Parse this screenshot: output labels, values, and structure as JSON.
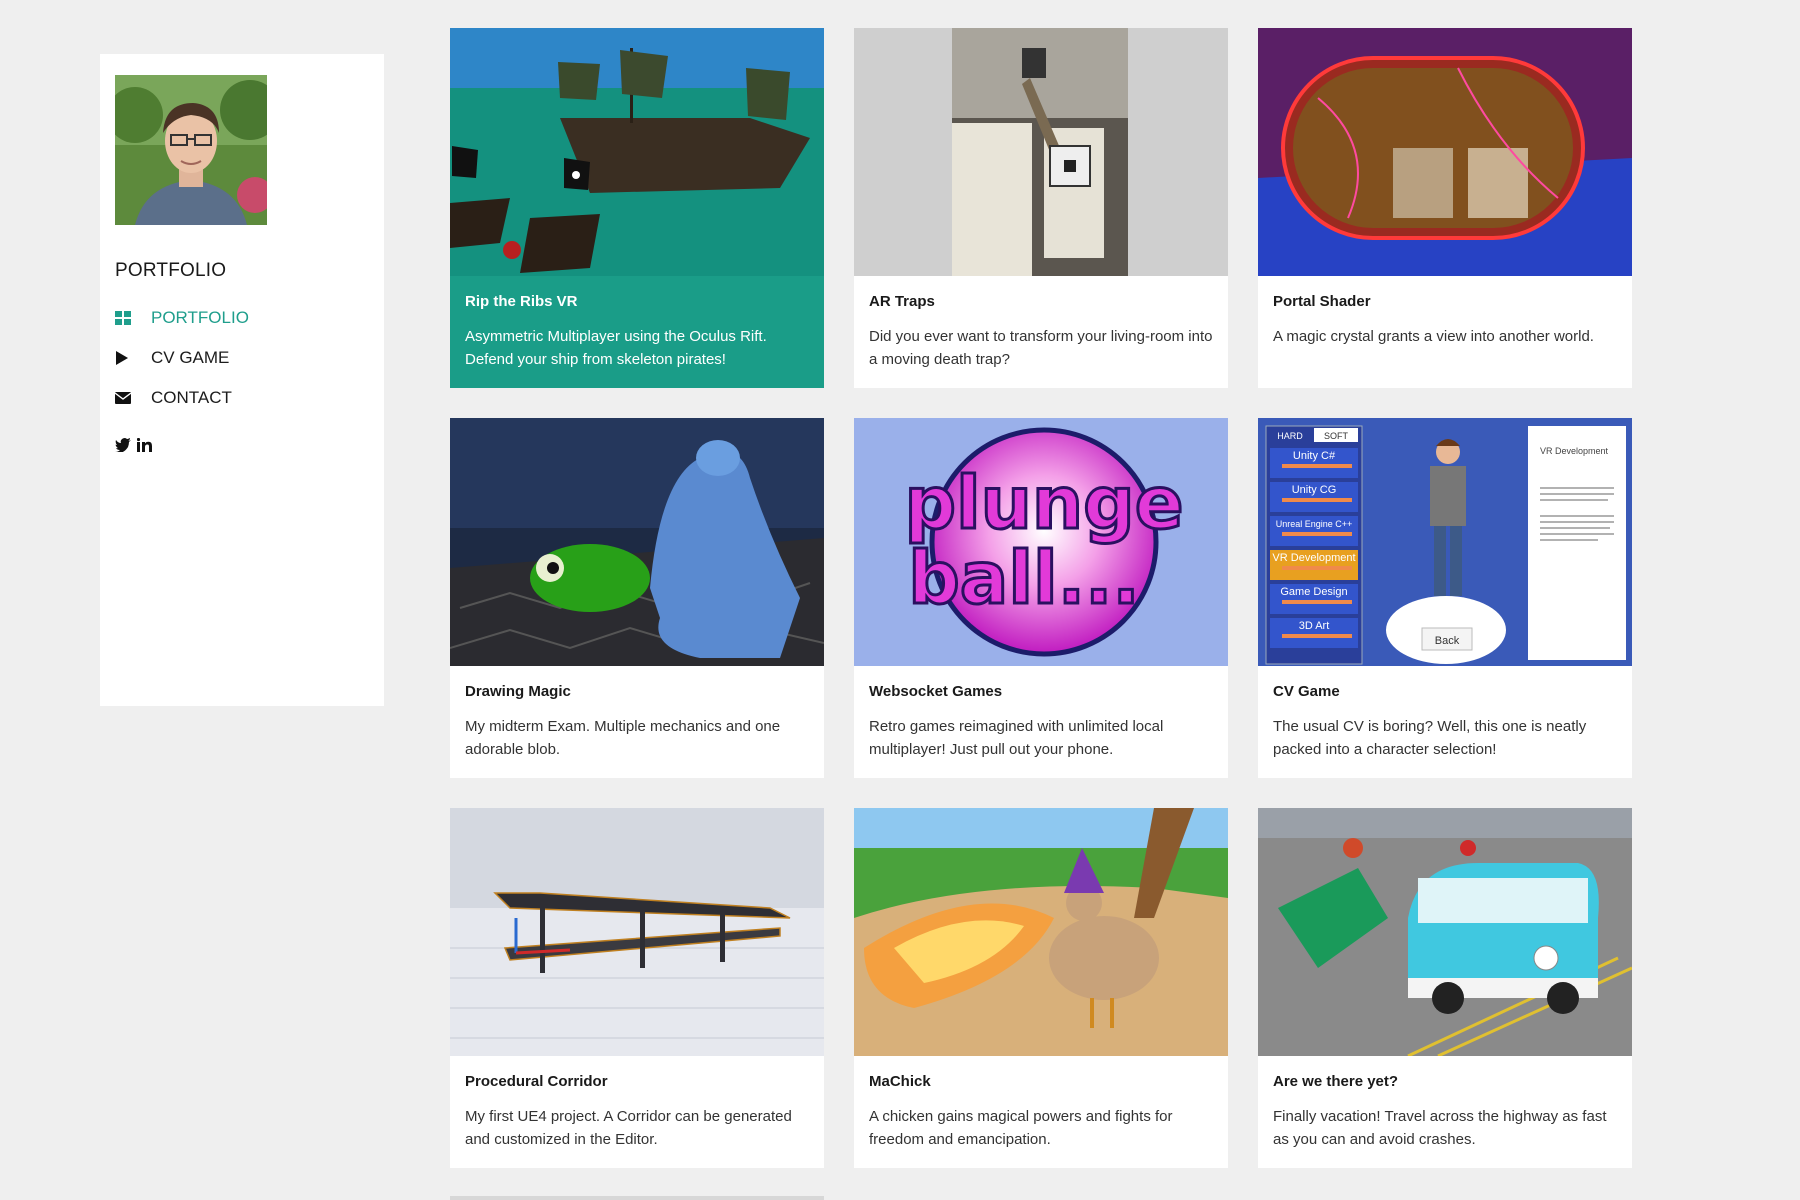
{
  "sidebar": {
    "brand": "PORTFOLIO",
    "nav": [
      {
        "label": "PORTFOLIO",
        "icon": "grid-icon",
        "active": true
      },
      {
        "label": "CV GAME",
        "icon": "play-icon",
        "active": false
      },
      {
        "label": "CONTACT",
        "icon": "envelope-icon",
        "active": false
      }
    ],
    "social": [
      "twitter-icon",
      "linkedin-icon"
    ]
  },
  "colors": {
    "accent": "#1a9d88",
    "background": "#efefef",
    "card": "#ffffff"
  },
  "projects": [
    {
      "title": "Rip the Ribs VR",
      "description": "Asymmetric Multiplayer using the Oculus Rift. Defend your ship from skeleton pirates!"
    },
    {
      "title": "AR Traps",
      "description": "Did you ever want to transform your living-room into a moving death trap?"
    },
    {
      "title": "Portal Shader",
      "description": "A magic crystal grants a view into another world."
    },
    {
      "title": "Drawing Magic",
      "description": "My midterm Exam. Multiple mechanics and one adorable blob."
    },
    {
      "title": "Websocket Games",
      "description": "Retro games reimagined with unlimited local multiplayer! Just pull out your phone."
    },
    {
      "title": "CV Game",
      "description": "The usual CV is boring? Well, this one is neatly packed into a character selection!"
    },
    {
      "title": "Procedural Corridor",
      "description": "My first UE4 project. A Corridor can be generated and customized in the Editor."
    },
    {
      "title": "MaChick",
      "description": "A chicken gains magical powers and fights for freedom and emancipation."
    },
    {
      "title": "Are we there yet?",
      "description": "Finally vacation! Travel across the highway as fast as you can and avoid crashes."
    }
  ],
  "thumb_text": {
    "plunge_logo_line1": "plunge",
    "plunge_logo_line2": "ball...",
    "cv_tabs": [
      "HARD",
      "SOFT"
    ],
    "cv_skills": [
      "Unity C#",
      "Unity CG",
      "Unreal Engine C++",
      "VR Development",
      "Game Design",
      "3D Art"
    ],
    "cv_panel_title": "VR Development",
    "cv_back": "Back"
  }
}
